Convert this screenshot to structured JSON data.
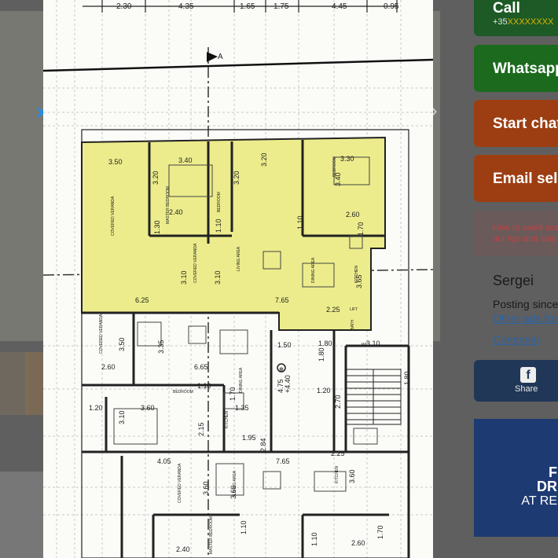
{
  "floor_plan": {
    "top_dimensions": [
      "2.30",
      "4.35",
      "1.65",
      "1.75",
      "4.45",
      "0.95"
    ],
    "section_marker": "A",
    "room_labels": [
      "COVERED VERANDA",
      "COVERED VERANDA",
      "BEDROOM",
      "BEDROOM",
      "MASTER BEDROOM",
      "LIVING AREA",
      "DINING AREA",
      "KITCHEN",
      "BATH",
      "WC",
      "LIFT",
      "COVERED VERANDA",
      "BEDROOM",
      "KITCHEN",
      "DINING AREA",
      "COVERED VERANDA",
      "LIVING AREA",
      "KITCHEN",
      "MASTER BEDROOM"
    ],
    "dimensions": [
      "3.50",
      "3.40",
      "3.20",
      "3.20",
      "3.30",
      "3.20",
      "2.40",
      "2.60",
      "3.40",
      "1.70",
      "1.30",
      "1.10",
      "1.10",
      "3.10",
      "3.10",
      "3.65",
      "6.25",
      "7.65",
      "2.25",
      "1.50",
      "1.80",
      "3.10",
      "1.80",
      "3.50",
      "3.35",
      "2.60",
      "6.65",
      "1.10",
      "4.75",
      "+4.40",
      "1.20",
      "3.60",
      "3.10",
      "1.35",
      "2.70",
      "1.20",
      "1.70",
      "1.80",
      "2.15",
      "1.95",
      "2.84",
      "7.65",
      "2.25",
      "4.05",
      "3.60",
      "3.60",
      "1.10",
      "1.10",
      "2.40",
      "2.60",
      "3.60",
      "1.70"
    ]
  },
  "sidebar": {
    "call_label": "Call",
    "call_number_prefix": "+35",
    "call_number_masked": "XXXXXXXX",
    "whatsapp_label": "Whatsapp",
    "chat_label": "Start chat",
    "email_label": "Email seller",
    "tip_line1": "How to avoid scams",
    "tip_line2": "our tips and stay",
    "seller_name": "Sergei",
    "posting_since": "Posting since",
    "other_ads": "Other ads from",
    "complain": "Complain",
    "share_label": "Share",
    "share_icon": "facebook-icon",
    "ad_line1": "F",
    "ad_line2": "DR",
    "ad_line3": "AT RE"
  },
  "colors": {
    "highlight": "#ecec8c",
    "call": "#1d5a26",
    "whatsapp": "#1c6a1e",
    "chat": "#9c3e12",
    "share": "#213758"
  }
}
